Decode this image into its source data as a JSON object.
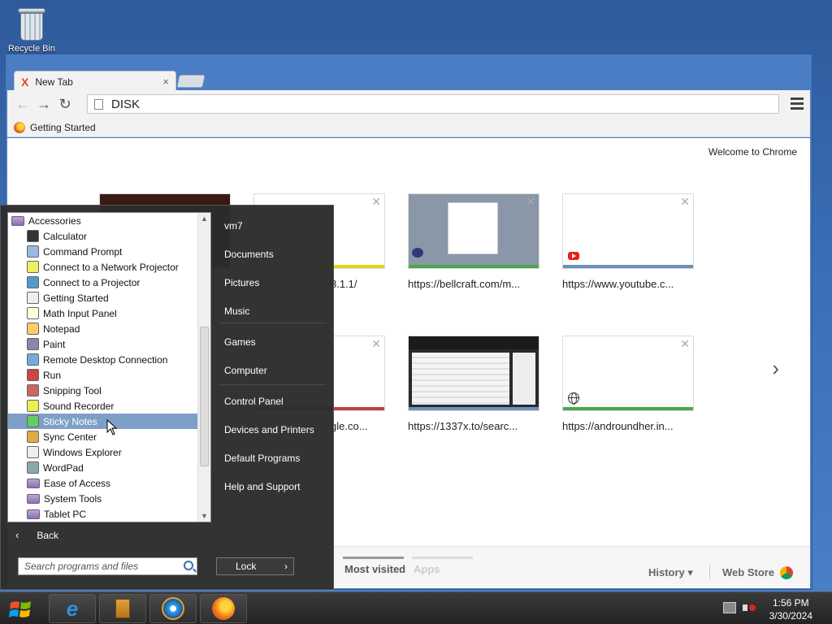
{
  "desktop": {
    "recycle_bin_label": "Recycle Bin"
  },
  "browser": {
    "tab_title": "New Tab",
    "tab_close": "×",
    "address": "DISK",
    "bookmark": "Getting Started",
    "welcome": "Welcome to Chrome",
    "tiles": [
      {
        "label": "",
        "bar": "#e22a1c"
      },
      {
        "label": "8.1.1/",
        "bar": "#e2d21c"
      },
      {
        "label": "https://bellcraft.com/m...",
        "bar": "#4aa84a"
      },
      {
        "label": "https://www.youtube.c...",
        "bar": "#6b8fb8"
      },
      {
        "label": "gle.co...",
        "bar": "#c04040"
      },
      {
        "label": "https://1337x.to/searc...",
        "bar": "#6b8fb8"
      },
      {
        "label": "https://androundher.in...",
        "bar": "#4aa84a"
      }
    ],
    "bottom": {
      "most_visited": "Most visited",
      "apps": "Apps",
      "history": "History",
      "web_store": "Web Store"
    }
  },
  "start_menu": {
    "programs": [
      {
        "label": "Accessories",
        "type": "folder-open"
      },
      {
        "label": "Calculator"
      },
      {
        "label": "Command Prompt"
      },
      {
        "label": "Connect to a Network Projector"
      },
      {
        "label": "Connect to a Projector"
      },
      {
        "label": "Getting Started"
      },
      {
        "label": "Math Input Panel"
      },
      {
        "label": "Notepad"
      },
      {
        "label": "Paint"
      },
      {
        "label": "Remote Desktop Connection"
      },
      {
        "label": "Run"
      },
      {
        "label": "Snipping Tool"
      },
      {
        "label": "Sound Recorder"
      },
      {
        "label": "Sticky Notes",
        "selected": true
      },
      {
        "label": "Sync Center"
      },
      {
        "label": "Windows Explorer"
      },
      {
        "label": "WordPad"
      },
      {
        "label": "Ease of Access",
        "type": "folder"
      },
      {
        "label": "System Tools",
        "type": "folder"
      },
      {
        "label": "Tablet PC",
        "type": "folder"
      }
    ],
    "back": "Back",
    "search_placeholder": "Search programs and files",
    "right_items": [
      "vm7",
      "Documents",
      "Pictures",
      "Music",
      "Games",
      "Computer",
      "Control Panel",
      "Devices and Printers",
      "Default Programs",
      "Help and Support"
    ],
    "lock": "Lock"
  },
  "taskbar": {
    "time": "1:56 PM",
    "date": "3/30/2024"
  }
}
